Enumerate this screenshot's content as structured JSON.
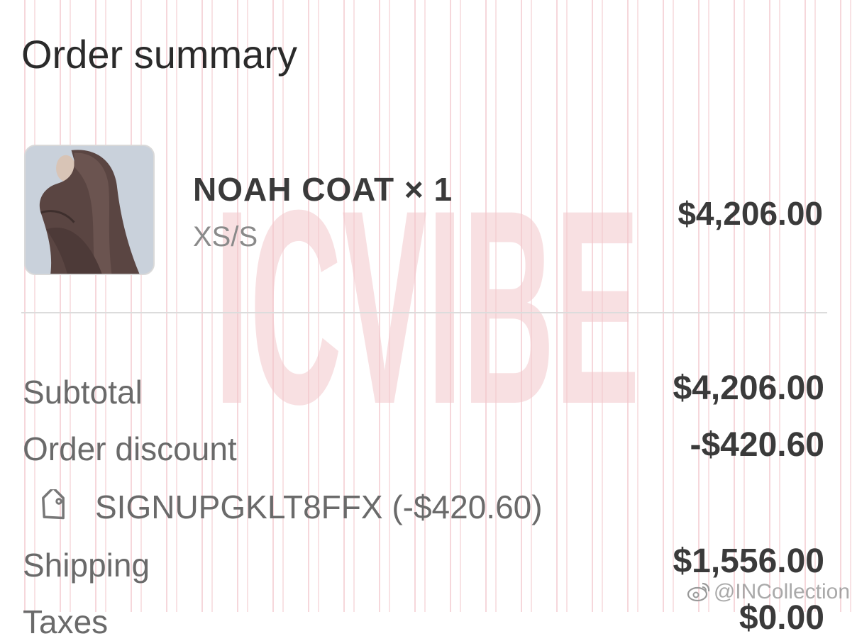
{
  "header": {
    "title": "Order summary"
  },
  "line_item": {
    "name": "NOAH COAT × 1",
    "variant": "XS/S",
    "price": "$4,206.00",
    "image_icon": "product-photo"
  },
  "totals": {
    "subtotal_label": "Subtotal",
    "subtotal_value": "$4,206.00",
    "discount_label": "Order discount",
    "discount_value": "-$420.60",
    "discount_code": "SIGNUPGKLT8FFX (-$420.60)",
    "discount_icon": "tag-icon",
    "shipping_label": "Shipping",
    "shipping_value": "$1,556.00",
    "taxes_label": "Taxes",
    "taxes_value": "$0.00"
  },
  "watermark": {
    "text": "ICVIBE",
    "handle": "@INCollection"
  },
  "colors": {
    "watermark": "#f2c6cb",
    "background_lines": "#e896a0",
    "divider": "#dcdcdc"
  }
}
